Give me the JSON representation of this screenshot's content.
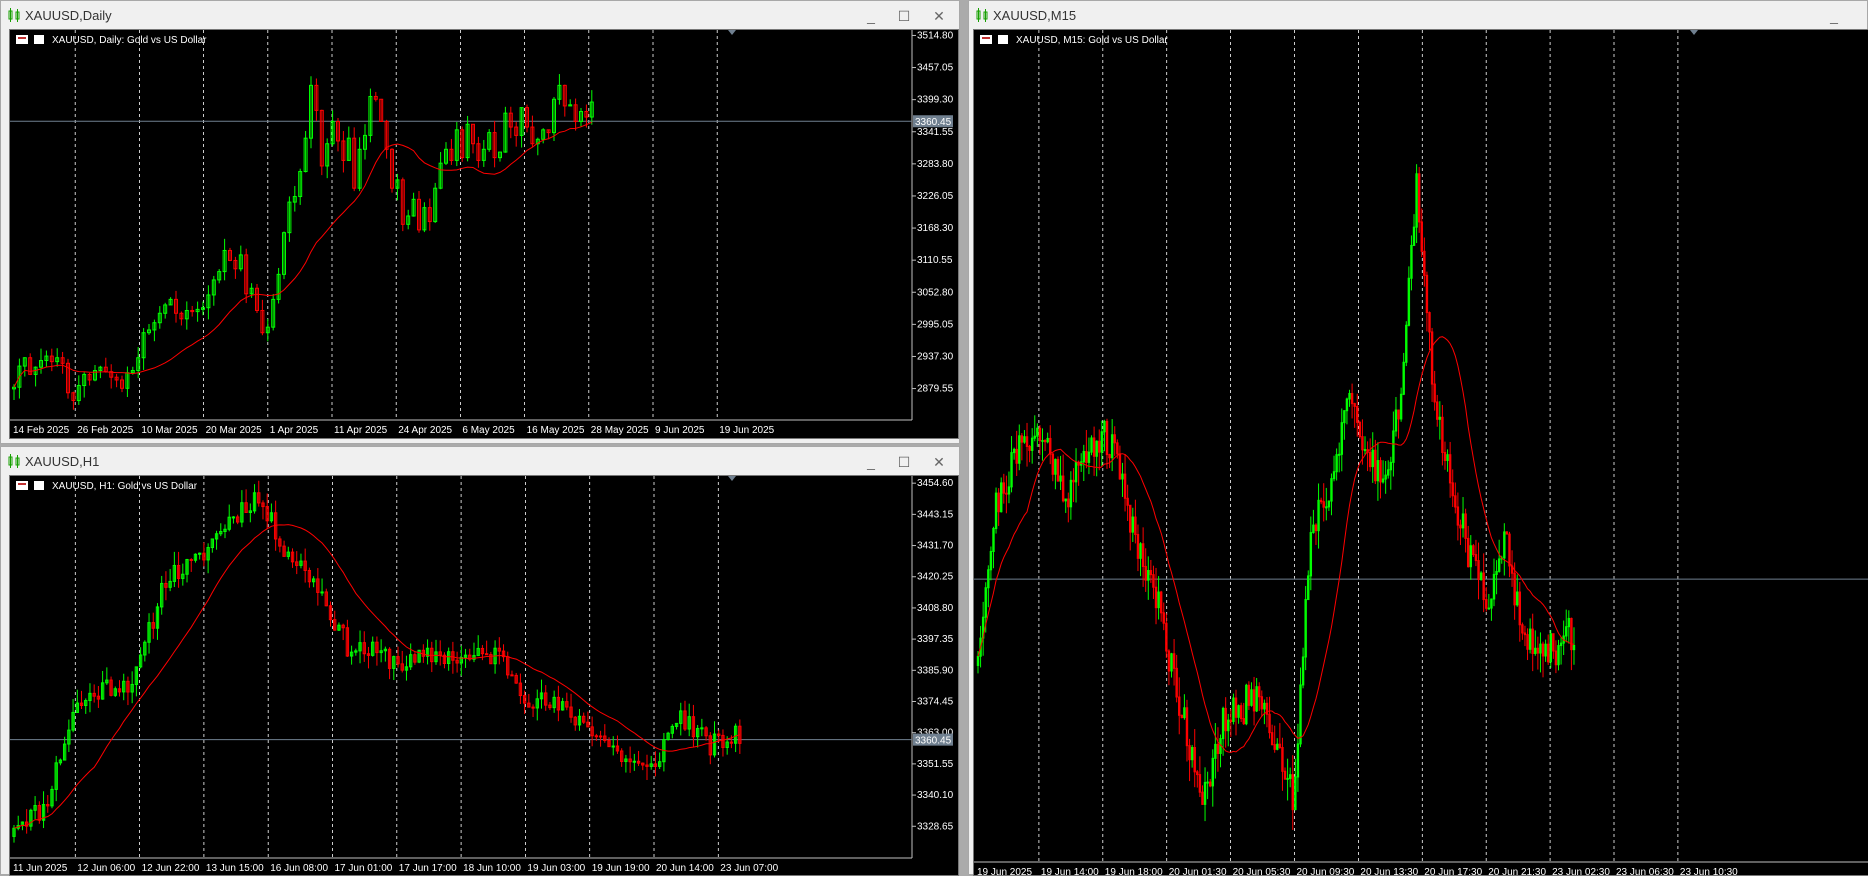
{
  "windows": [
    {
      "key": "daily",
      "title": "XAUUSD,Daily",
      "chart_label": "XAUUSD, Daily:  Gold vs US Dollar",
      "controls": [
        "_",
        "☐",
        "✕"
      ]
    },
    {
      "key": "h1",
      "title": "XAUUSD,H1",
      "chart_label": "XAUUSD, H1:  Gold vs US Dollar",
      "controls": [
        "_",
        "☐",
        "✕"
      ]
    },
    {
      "key": "m15",
      "title": "XAUUSD,M15",
      "chart_label": "XAUUSD, M15:  Gold vs US Dollar",
      "controls": [
        "_",
        "☐",
        "✕"
      ]
    }
  ],
  "colors": {
    "background": "#000000",
    "bull": "#00ff00",
    "bear": "#ff0000",
    "moving_average": "#ff0000",
    "bid_line": "#708090",
    "grid": "#ffffff"
  },
  "chart_data": [
    {
      "type": "candlestick",
      "symbol": "XAUUSD",
      "timeframe": "Daily",
      "title": "XAUUSD, Daily:  Gold vs US Dollar",
      "y_ticks": [
        3514.8,
        3457.05,
        3399.3,
        3341.55,
        3283.8,
        3226.05,
        3168.3,
        3110.55,
        3052.8,
        2995.05,
        2937.3,
        2879.55
      ],
      "ylim": [
        2823.0,
        3521.0
      ],
      "x_ticks": [
        "14 Feb 2025",
        "26 Feb 2025",
        "10 Mar 2025",
        "20 Mar 2025",
        "1 Apr 2025",
        "11 Apr 2025",
        "24 Apr 2025",
        "6 May 2025",
        "16 May 2025",
        "28 May 2025",
        "9 Jun 2025",
        "19 Jun 2025"
      ],
      "current_price": 3360.45,
      "current_price_label": "3360.45",
      "ma_period": 20,
      "closes": [
        2882,
        2920,
        2935,
        2905,
        2918,
        2930,
        2938,
        2928,
        2935,
        2925,
        2872,
        2858,
        2885,
        2905,
        2895,
        2912,
        2918,
        2910,
        2900,
        2895,
        2880,
        2908,
        2912,
        2935,
        2980,
        2985,
        2998,
        3015,
        3030,
        3040,
        3015,
        3005,
        3020,
        3018,
        3022,
        3025,
        3048,
        3075,
        3090,
        3128,
        3110,
        3095,
        3120,
        3050,
        3060,
        3020,
        2980,
        2990,
        3040,
        3085,
        3160,
        3215,
        3225,
        3270,
        3330,
        3425,
        3380,
        3280,
        3320,
        3360,
        3325,
        3290,
        3330,
        3240,
        3310,
        3335,
        3405,
        3400,
        3360,
        3310,
        3240,
        3255,
        3175,
        3190,
        3220,
        3165,
        3205,
        3180,
        3240,
        3285,
        3310,
        3290,
        3345,
        3295,
        3355,
        3320,
        3290,
        3310,
        3340,
        3295,
        3305,
        3375,
        3350,
        3335,
        3385,
        3350,
        3320,
        3328,
        3345,
        3340,
        3400,
        3425,
        3388,
        3390,
        3360,
        3378,
        3368,
        3395
      ]
    },
    {
      "type": "candlestick",
      "symbol": "XAUUSD",
      "timeframe": "H1",
      "title": "XAUUSD, H1:  Gold vs US Dollar",
      "y_ticks": [
        3454.6,
        3443.15,
        3431.7,
        3420.25,
        3408.8,
        3397.35,
        3385.9,
        3374.45,
        3363.0,
        3351.55,
        3340.1,
        3328.65
      ],
      "ylim": [
        3317.0,
        3456.5
      ],
      "x_ticks": [
        "11 Jun 2025",
        "12 Jun 06:00",
        "12 Jun 22:00",
        "13 Jun 15:00",
        "16 Jun 08:00",
        "17 Jun 01:00",
        "17 Jun 17:00",
        "18 Jun 10:00",
        "19 Jun 03:00",
        "19 Jun 19:00",
        "20 Jun 14:00",
        "23 Jun 07:00"
      ],
      "current_price": 3360.45,
      "current_price_label": "3360.45",
      "ma_period": 20
    },
    {
      "type": "candlestick",
      "symbol": "XAUUSD",
      "timeframe": "M15",
      "title": "XAUUSD, M15:  Gold vs US Dollar",
      "x_ticks": [
        "19 Jun 2025",
        "19 Jun 14:00",
        "19 Jun 18:00",
        "20 Jun 01:30",
        "20 Jun 05:30",
        "20 Jun 09:30",
        "20 Jun 13:30",
        "20 Jun 17:30",
        "20 Jun 21:30",
        "23 Jun 02:30",
        "23 Jun 06:30",
        "23 Jun 10:30"
      ],
      "ma_period": 20
    }
  ]
}
